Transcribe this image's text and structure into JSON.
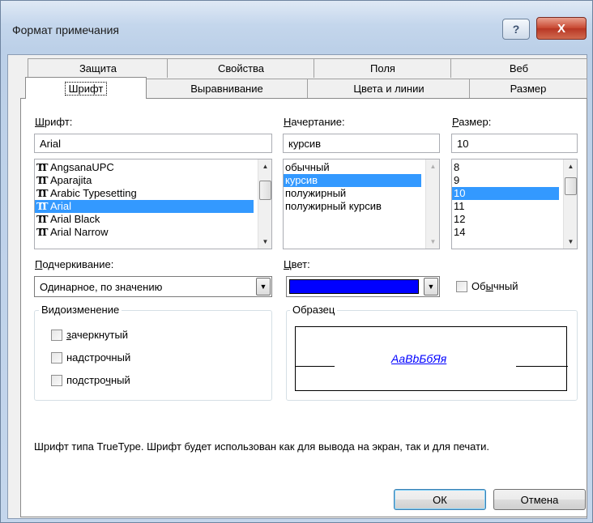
{
  "window": {
    "title": "Формат примечания",
    "help_label": "?",
    "close_label": "X"
  },
  "tabs": {
    "back_row": [
      "Защита",
      "Свойства",
      "Поля",
      "Веб"
    ],
    "front_row": [
      "Шрифт",
      "Выравнивание",
      "Цвета и линии",
      "Размер"
    ],
    "active": "Шрифт"
  },
  "font": {
    "label_hotkey": "Ш",
    "label_rest": "рифт:",
    "value": "Arial",
    "items": [
      "AngsanaUPC",
      "Aparajita",
      "Arabic Typesetting",
      "Arial",
      "Arial Black",
      "Arial Narrow"
    ],
    "selected": "Arial",
    "icon": "truetype-icon"
  },
  "style": {
    "label_hotkey": "Н",
    "label_rest": "ачертание:",
    "value": "курсив",
    "items": [
      "обычный",
      "курсив",
      "полужирный",
      "полужирный курсив"
    ],
    "selected": "курсив"
  },
  "size": {
    "label_hotkey": "Р",
    "label_rest": "азмер:",
    "value": "10",
    "items": [
      "8",
      "9",
      "10",
      "11",
      "12",
      "14"
    ],
    "selected": "10"
  },
  "underline": {
    "label_hotkey": "П",
    "label_rest": "одчеркивание:",
    "value": "Одинарное, по значению"
  },
  "color": {
    "label_hotkey": "Ц",
    "label_rest": "вет:",
    "swatch": "#0000ff",
    "normal_pre": "Об",
    "normal_hotkey": "ы",
    "normal_post": "чный"
  },
  "effects": {
    "title": "Видоизменение",
    "strikethrough": {
      "hotkey": "з",
      "rest": "ачеркнутый"
    },
    "superscript": {
      "pre": "на",
      "hotkey": "д",
      "post": "строчный"
    },
    "subscript": {
      "pre": "подстро",
      "hotkey": "ч",
      "post": "ный"
    }
  },
  "preview": {
    "title": "Образец",
    "text": "AaBbБбЯя"
  },
  "description": "Шрифт типа TrueType. Шрифт будет использован как для вывода на экран, так и для печати.",
  "buttons": {
    "ok": "ОК",
    "cancel": "Отмена"
  },
  "colors": {
    "selection": "#3399ff",
    "sample_text": "#0000ff"
  }
}
